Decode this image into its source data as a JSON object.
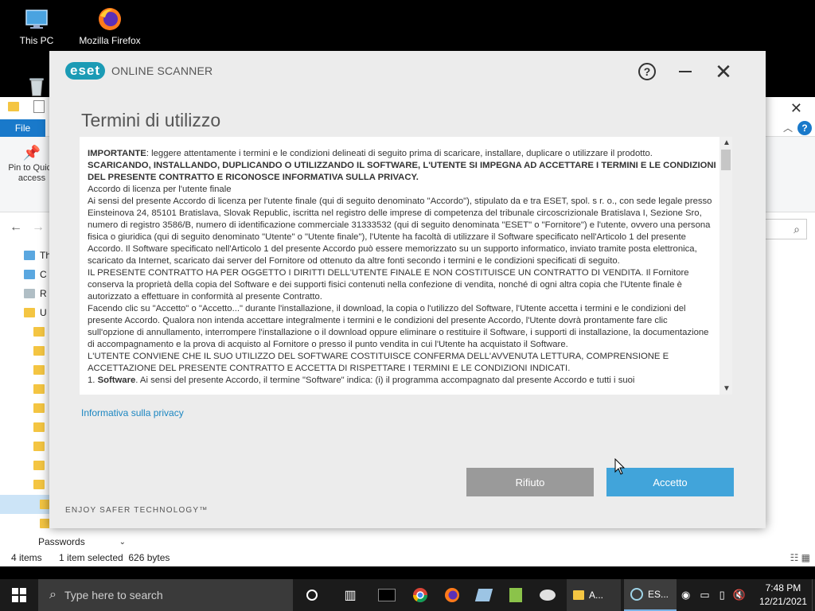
{
  "desktop": {
    "icons": [
      {
        "label": "This PC",
        "icon": "this-pc-icon"
      },
      {
        "label": "Mozilla Firefox",
        "icon": "firefox-icon"
      },
      {
        "label": "",
        "icon": "recycle-bin-icon"
      }
    ]
  },
  "explorer": {
    "file_tab": "File",
    "pin_label": "Pin to Quick access",
    "tree_items": [
      "Th",
      "C",
      "R",
      "U"
    ],
    "passwords_label": "Passwords",
    "status_items": "4 items",
    "status_selected": "1 item selected  626 bytes",
    "help_label": "?"
  },
  "eset": {
    "brand": "eset",
    "product": "ONLINE SCANNER",
    "title": "Termini di utilizzo",
    "help_label": "?",
    "privacy_link": "Informativa sulla privacy",
    "reject_button": "Rifiuto",
    "accept_button": "Accetto",
    "footer": "ENJOY SAFER TECHNOLOGY™",
    "license": {
      "p1_bold": "IMPORTANTE",
      "p1_rest": ": leggere attentamente i termini e le condizioni delineati di seguito prima di scaricare, installare, duplicare o utilizzare il prodotto.",
      "p2_bold": "SCARICANDO, INSTALLANDO, DUPLICANDO O UTILIZZANDO IL SOFTWARE, L'UTENTE SI IMPEGNA AD ACCETTARE I TERMINI E LE CONDIZIONI DEL PRESENTE CONTRATTO E RICONOSCE INFORMATIVA SULLA PRIVACY.",
      "p3": "Accordo di licenza per l'utente finale",
      "p4": "Ai sensi del presente Accordo di licenza per l'utente finale (qui di seguito denominato \"Accordo\"), stipulato da e tra ESET, spol. s r. o., con sede legale presso Einsteinova 24, 85101 Bratislava, Slovak Republic, iscritta nel registro delle imprese di competenza del tribunale circoscrizionale Bratislava I, Sezione Sro, numero di registro 3586/B, numero di identificazione commerciale 31333532 (qui di seguito denominata \"ESET\" o \"Fornitore\") e l'utente, ovvero una persona fisica o giuridica (qui di seguito denominato \"Utente\" o \"Utente finale\"), l'Utente ha facoltà di utilizzare il Software specificato nell'Articolo 1 del presente Accordo. Il Software specificato nell'Articolo 1 del presente Accordo può essere memorizzato su un supporto informatico, inviato tramite posta elettronica, scaricato da Internet, scaricato dai server del Fornitore od ottenuto da altre fonti secondo i termini e le condizioni specificati di seguito.",
      "p5": "IL PRESENTE CONTRATTO HA PER OGGETTO I DIRITTI DELL'UTENTE FINALE E NON COSTITUISCE UN CONTRATTO DI VENDITA. Il Fornitore conserva la proprietà della copia del Software e dei supporti fisici contenuti nella confezione di vendita, nonché di ogni altra copia che l'Utente finale è autorizzato a effettuare in conformità al presente Contratto.",
      "p6": "Facendo clic su \"Accetto\" o \"Accetto...\" durante l'installazione, il download, la copia o l'utilizzo del Software, l'Utente accetta i termini e le condizioni del presente Accordo. Qualora non intenda accettare integralmente i termini e le condizioni del presente Accordo, l'Utente dovrà prontamente fare clic sull'opzione di annullamento, interrompere l'installazione o il download oppure eliminare o restituire il Software, i supporti di installazione, la documentazione di accompagnamento e la prova di acquisto al Fornitore o presso il punto vendita in cui l'Utente ha acquistato il Software.",
      "p7": "L'UTENTE CONVIENE CHE IL SUO UTILIZZO DEL SOFTWARE COSTITUISCE CONFERMA DELL'AVVENUTA LETTURA, COMPRENSIONE E ACCETTAZIONE DEL PRESENTE CONTRATTO E ACCETTA DI RISPETTARE I TERMINI E LE CONDIZIONI INDICATI.",
      "p8_num": "1. ",
      "p8_bold": "Software",
      "p8_rest": ". Ai sensi del presente Accordo, il termine \"Software\" indica: (i) il programma accompagnato dal presente Accordo e tutti i suoi"
    }
  },
  "taskbar": {
    "search_placeholder": "Type here to search",
    "apps": [
      {
        "label": "A...",
        "icon": "folder-icon"
      },
      {
        "label": "ES...",
        "icon": "eset-icon"
      }
    ],
    "time": "7:48 PM",
    "date": "12/21/2021"
  },
  "colors": {
    "eset_accent": "#1b9bb5",
    "accept_button": "#41a4da",
    "reject_button": "#9a9a9a",
    "link": "#1b86c1"
  }
}
